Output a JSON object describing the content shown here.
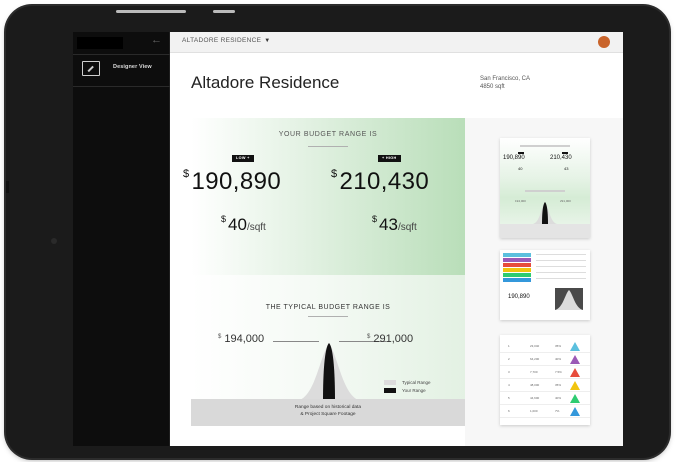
{
  "colors": {
    "accent_green": "#b9deb9",
    "avatar": "#c9642b",
    "typical_range": "#dcdcdc",
    "your_range": "#111111"
  },
  "sidebar": {
    "nav_label": "Designer View",
    "nav_icon": "designer-view-icon",
    "back_icon": "arrow-left-icon"
  },
  "topbar": {
    "project": "ALTADORE RESIDENCE"
  },
  "page": {
    "title": "Altadore Residence",
    "location_city": "San Francisco, CA",
    "location_size": "4850 sqft"
  },
  "budget": {
    "heading": "YOUR BUDGET RANGE IS",
    "low_tag": "LOW +",
    "high_tag": "+ HIGH",
    "currency": "$",
    "low_value": "190,890",
    "high_value": "210,430",
    "low_sqft": "40",
    "high_sqft": "43",
    "sqft_unit": "/sqft"
  },
  "typical": {
    "heading": "THE TYPICAL BUDGET RANGE IS",
    "low_value": "194,000",
    "high_value": "291,000",
    "legend_typical": "Typical Range",
    "legend_yours": "Your Range",
    "footer_line1": "Range based on historical data",
    "footer_line2": "& Project Square Footage"
  },
  "thumbnails": {
    "t1_low": "190,890",
    "t1_high": "210,430",
    "t1_low_sqft": "40",
    "t1_high_sqft": "43",
    "t2_value": "190,890",
    "t3_rows": [
      {
        "n": "1",
        "a": "23,040",
        "p": "35%",
        "c": "#5bc0de"
      },
      {
        "n": "2",
        "a": "64,200",
        "p": "40%",
        "c": "#9b59b6"
      },
      {
        "n": "3",
        "a": "7,700",
        "p": "7.5%",
        "c": "#e74c3c"
      },
      {
        "n": "4",
        "a": "48,000",
        "p": "35%",
        "c": "#f1c40f"
      },
      {
        "n": "5",
        "a": "44,600",
        "p": "40%",
        "c": "#2ecc71"
      },
      {
        "n": "6",
        "a": "1,000",
        "p": "7%",
        "c": "#3498db"
      }
    ]
  }
}
